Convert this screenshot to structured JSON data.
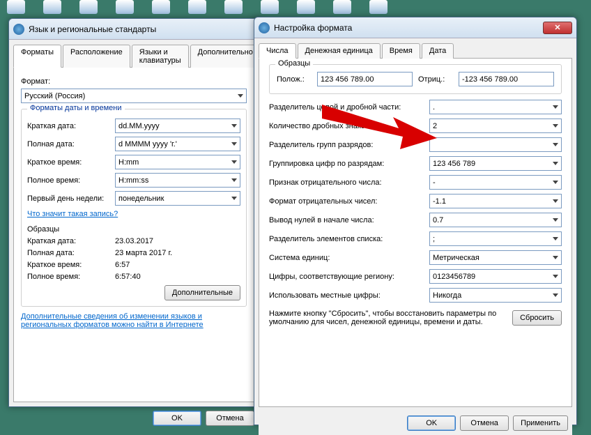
{
  "left": {
    "title": "Язык и региональные стандарты",
    "tabs": [
      "Форматы",
      "Расположение",
      "Языки и клавиатуры",
      "Дополнительно"
    ],
    "format_label": "Формат:",
    "format_value": "Русский (Россия)",
    "datetime_legend": "Форматы даты и времени",
    "fields": {
      "short_date_lbl": "Краткая дата:",
      "short_date_val": "dd.MM.yyyy",
      "long_date_lbl": "Полная дата:",
      "long_date_val": "d MMMM yyyy 'г.'",
      "short_time_lbl": "Краткое время:",
      "short_time_val": "H:mm",
      "long_time_lbl": "Полное время:",
      "long_time_val": "H:mm:ss",
      "first_day_lbl": "Первый день недели:",
      "first_day_val": "понедельник"
    },
    "what_link": "Что значит такая запись?",
    "samples_legend": "Образцы",
    "samples": {
      "short_date_lbl": "Краткая дата:",
      "short_date_val": "23.03.2017",
      "long_date_lbl": "Полная дата:",
      "long_date_val": "23 марта 2017 г.",
      "short_time_lbl": "Краткое время:",
      "short_time_val": "6:57",
      "long_time_lbl": "Полное время:",
      "long_time_val": "6:57:40"
    },
    "additional_btn": "Дополнительные",
    "help_link": "Дополнительные сведения об изменении языков и региональных форматов можно найти в Интернете",
    "ok": "OK",
    "cancel": "Отмена"
  },
  "right": {
    "title": "Настройка формата",
    "tabs": [
      "Числа",
      "Денежная единица",
      "Время",
      "Дата"
    ],
    "samples_legend": "Образцы",
    "pos_lbl": "Полож.:",
    "pos_val": "123 456 789.00",
    "neg_lbl": "Отриц.:",
    "neg_val": "-123 456 789.00",
    "rows": [
      {
        "label": "Разделитель целой и дробной части:",
        "value": "."
      },
      {
        "label": "Количество дробных знаков:",
        "value": "2"
      },
      {
        "label": "Разделитель групп разрядов:",
        "value": ""
      },
      {
        "label": "Группировка цифр по разрядам:",
        "value": "123 456 789"
      },
      {
        "label": "Признак отрицательного числа:",
        "value": "-"
      },
      {
        "label": "Формат отрицательных чисел:",
        "value": "-1.1"
      },
      {
        "label": "Вывод нулей в начале числа:",
        "value": "0.7"
      },
      {
        "label": "Разделитель элементов списка:",
        "value": ";"
      },
      {
        "label": "Система единиц:",
        "value": "Метрическая"
      },
      {
        "label": "Цифры, соответствующие региону:",
        "value": "0123456789"
      },
      {
        "label": "Использовать местные цифры:",
        "value": "Никогда"
      }
    ],
    "reset_msg": "Нажмите кнопку \"Сбросить\", чтобы восстановить параметры по умолчанию для чисел, денежной единицы, времени и даты.",
    "reset_btn": "Сбросить",
    "ok": "OK",
    "cancel": "Отмена",
    "apply": "Применить"
  }
}
